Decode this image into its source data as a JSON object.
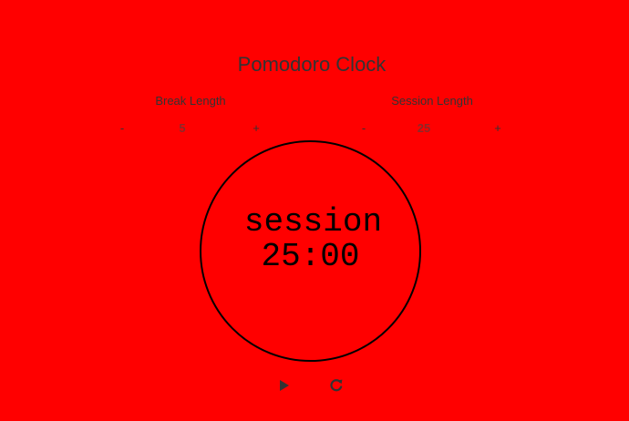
{
  "app": {
    "title": "Pomodoro Clock"
  },
  "break": {
    "label": "Break Length",
    "decrement_label": "-",
    "value": "5",
    "increment_label": "+"
  },
  "session": {
    "label": "Session Length",
    "decrement_label": "-",
    "value": "25",
    "increment_label": "+"
  },
  "timer": {
    "mode": "session",
    "time": "25:00"
  },
  "controls": {
    "play_icon": "play-icon",
    "reset_icon": "reset-icon"
  },
  "colors": {
    "background": "#ff0000",
    "text": "#333333",
    "value": "#8a2a2a",
    "ring": "#000000"
  }
}
